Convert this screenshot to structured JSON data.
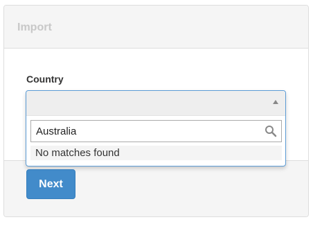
{
  "panel": {
    "title": "Import"
  },
  "form": {
    "country_label": "Country",
    "country_select": {
      "selected": "",
      "search_value": "Australia",
      "no_results_text": "No matches found"
    }
  },
  "footer": {
    "next_label": "Next"
  },
  "colors": {
    "accent": "#428bca",
    "focus_border": "#5b9bd5"
  }
}
